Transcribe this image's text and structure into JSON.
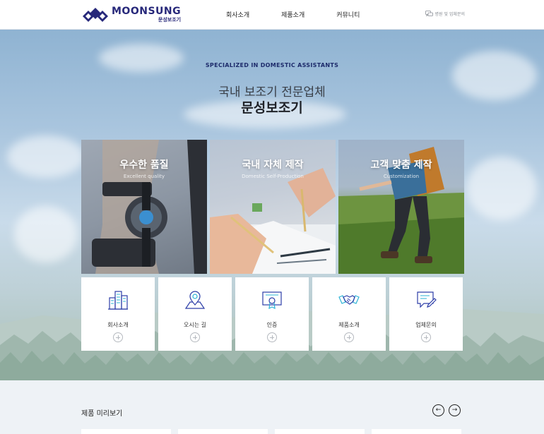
{
  "header": {
    "logo_word": "MOONSUNG",
    "logo_sub": "문성보조기",
    "nav": [
      "회사소개",
      "제품소개",
      "커뮤니티"
    ],
    "inquiry_label": "병원 및 업체문의"
  },
  "hero": {
    "tagline": "SPECIALIZED IN DOMESTIC ASSISTANTS",
    "subtitle": "국내 보조기 전문업체",
    "title": "문성보조기"
  },
  "panels": [
    {
      "title": "우수한 품질",
      "subtitle": "Excellent quality"
    },
    {
      "title": "국내 자체 제작",
      "subtitle": "Domestic Self-Production"
    },
    {
      "title": "고객 맞춤 제작",
      "subtitle": "Customization"
    }
  ],
  "cards": [
    {
      "label": "회사소개",
      "icon": "building-icon"
    },
    {
      "label": "오시는 길",
      "icon": "map-pin-icon"
    },
    {
      "label": "인증",
      "icon": "certificate-icon"
    },
    {
      "label": "제품소개",
      "icon": "handshake-icon"
    },
    {
      "label": "업체문의",
      "icon": "inquiry-icon"
    }
  ],
  "preview": {
    "title": "제품 미리보기",
    "prev_symbol": "←",
    "next_symbol": "→"
  },
  "colors": {
    "brand": "#27287a",
    "icon_blue": "#2d3ea8",
    "icon_cyan": "#2bb3d6"
  }
}
